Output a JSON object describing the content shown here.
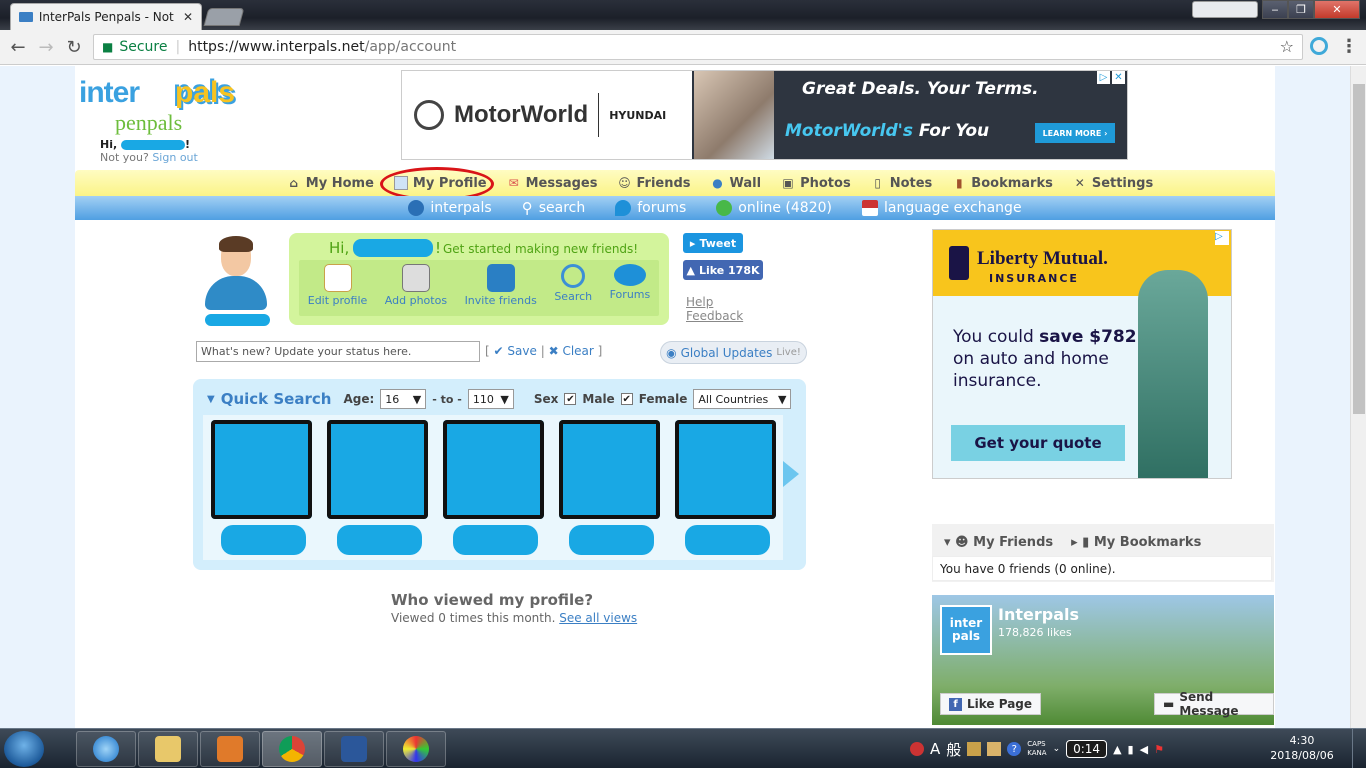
{
  "browser": {
    "tab_title": "InterPals Penpals - Not",
    "secure_label": "Secure",
    "url_host": "https://www.interpals.net",
    "url_path": "/app/account",
    "window_controls": {
      "minimize": "‒",
      "maximize": "❐",
      "close": "✕"
    }
  },
  "site": {
    "logo_inter": "inter",
    "logo_pals": "pals",
    "logo_penpals": "penpals",
    "greeting_prefix": "Hi,",
    "greeting_suffix": "!",
    "not_you": "Not you?",
    "sign_out": "Sign out"
  },
  "ad_top": {
    "brand": "MotorWorld",
    "partner": "HYUNDAI",
    "headline": "Great Deals. Your Terms.",
    "sub_accent": "MotorWorld's",
    "sub_rest": "For You",
    "cta": "LEARN MORE ›",
    "adchoices": "▷",
    "close": "✕"
  },
  "main_nav": [
    {
      "label": "My Home",
      "icon": "home-icon"
    },
    {
      "label": "My Profile",
      "icon": "profile-icon"
    },
    {
      "label": "Messages",
      "icon": "envelope-icon"
    },
    {
      "label": "Friends",
      "icon": "friends-icon"
    },
    {
      "label": "Wall",
      "icon": "wall-icon"
    },
    {
      "label": "Photos",
      "icon": "photos-icon"
    },
    {
      "label": "Notes",
      "icon": "notes-icon"
    },
    {
      "label": "Bookmarks",
      "icon": "bookmarks-icon"
    },
    {
      "label": "Settings",
      "icon": "settings-icon"
    }
  ],
  "sub_nav": [
    {
      "label": "interpals",
      "icon": "globe-icon"
    },
    {
      "label": "search",
      "icon": "search-icon"
    },
    {
      "label": "forums",
      "icon": "forums-icon"
    },
    {
      "label": "online (4820)",
      "icon": "online-icon"
    },
    {
      "label": "language exchange",
      "icon": "flag-icon"
    }
  ],
  "welcome": {
    "hi": "Hi,",
    "exclaim": "!",
    "started": "Get started making new friends!",
    "tools": [
      {
        "label": "Edit profile",
        "icon": "edit-profile-icon"
      },
      {
        "label": "Add photos",
        "icon": "camera-icon"
      },
      {
        "label": "Invite friends",
        "icon": "address-book-icon"
      },
      {
        "label": "Search",
        "icon": "magnifier-icon"
      },
      {
        "label": "Forums",
        "icon": "speech-bubble-icon"
      }
    ]
  },
  "social": {
    "tweet": "Tweet",
    "like": "Like 178K",
    "help": "Help",
    "feedback": "Feedback"
  },
  "status": {
    "placeholder": "What's new? Update your status here.",
    "open_bracket": "[",
    "save": "Save",
    "divider": "|",
    "clear": "Clear",
    "close_bracket": "]",
    "global_updates": "Global Updates",
    "live": "Live!"
  },
  "quick_search": {
    "title": "Quick Search",
    "age_label": "Age:",
    "age_from": "16",
    "to_label": "- to -",
    "age_to": "110",
    "sex_label": "Sex",
    "male_label": "Male",
    "male_checked": "✔",
    "female_label": "Female",
    "female_checked": "✔",
    "country": "All Countries"
  },
  "who_viewed": {
    "title": "Who viewed my profile?",
    "text": "Viewed 0 times this month.",
    "link": "See all views"
  },
  "ad_right": {
    "brand": "Liberty Mutual.",
    "brand_sub": "INSURANCE",
    "copy_pre": "You could ",
    "copy_bold": "save $782",
    "copy_post": " on auto and home insurance.",
    "cta": "Get your quote",
    "adchoices": "▷"
  },
  "friends_box": {
    "tab_friends": "My Friends",
    "tab_bookmarks": "My Bookmarks",
    "body": "You have 0 friends (0 online)."
  },
  "fb_widget": {
    "icon_text": "inter pals",
    "name": "Interpals",
    "likes": "178,826 likes",
    "like_page": "Like Page",
    "send_message": "Send Message"
  },
  "taskbar": {
    "ime": "A",
    "ime_mode": "般",
    "caps": "CAPS",
    "kana": "KANA",
    "timer": "0:14",
    "time": "4:30",
    "date": "2018/08/06"
  }
}
